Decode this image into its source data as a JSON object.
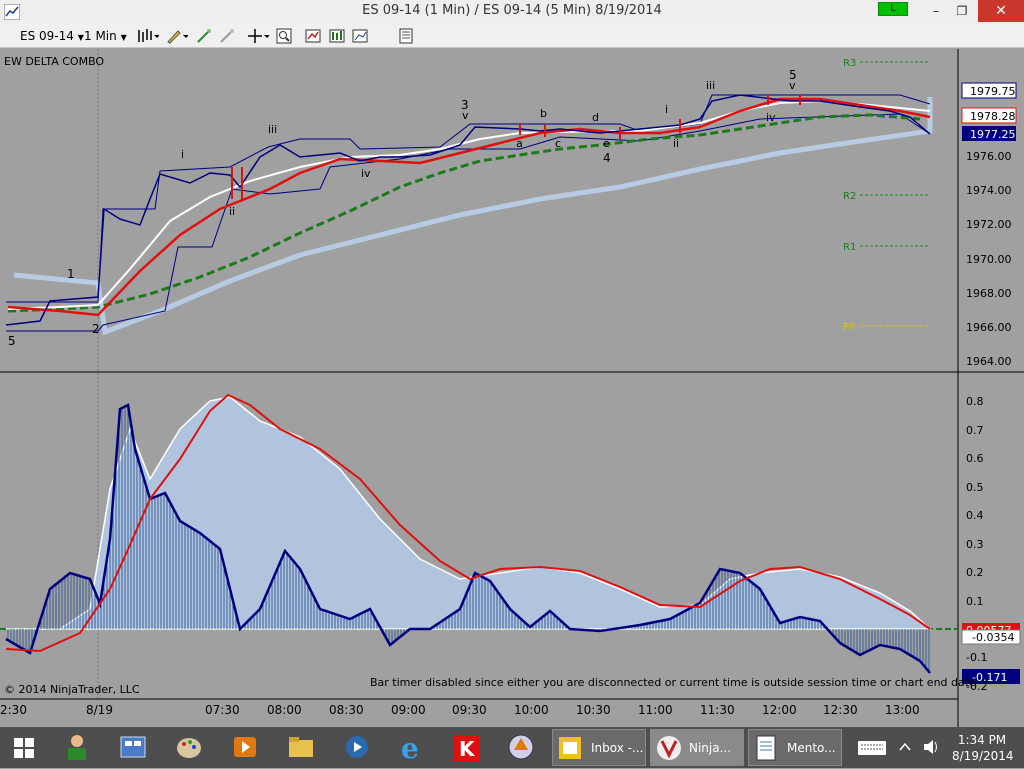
{
  "window": {
    "title": "ES 09-14 (1 Min) / ES 09-14 (5 Min)  8/19/2014",
    "connection_label": "L",
    "minimize_glyph": "–",
    "restore_glyph": "❐",
    "close_glyph": "✕"
  },
  "toolbar": {
    "instrument": "ES 09-14",
    "interval": "1 Min",
    "icons": [
      "bar-type-icon",
      "pencil-draw-icon",
      "magic-wand-icon",
      "eraser-icon",
      "crosshair-icon",
      "zoom-icon",
      "indicators-icon",
      "strategies-icon",
      "chart-properties-icon",
      "templates-icon"
    ]
  },
  "chart": {
    "indicator_label": "EW DELTA COMBO",
    "copyright": "© 2014 NinjaTrader, LLC",
    "status_message": "Bar timer disabled since either you are disconnected or current time is outside session time or chart end date",
    "price_ticks": [
      "1976.00",
      "1974.00",
      "1972.00",
      "1970.00",
      "1968.00",
      "1966.00",
      "1964.00"
    ],
    "price_markers": [
      "1979.75",
      "1978.28",
      "1977.25"
    ],
    "pivot_labels": [
      "R3",
      "R2",
      "R1",
      "PP"
    ],
    "osc_ticks": [
      "0.8",
      "0.7",
      "0.6",
      "0.5",
      "0.4",
      "0.3",
      "0.2",
      "0.1",
      "0",
      "-0.1",
      "-0.2"
    ],
    "osc_markers": [
      "0.00577",
      "-0.0354",
      "-0.171"
    ],
    "time_ticks": [
      "2:30",
      "8/19",
      "07:30",
      "08:00",
      "08:30",
      "09:00",
      "09:30",
      "10:00",
      "10:30",
      "11:00",
      "11:30",
      "12:00",
      "12:30",
      "13:00"
    ],
    "wave_labels": [
      "5",
      "1",
      "2",
      "i",
      "ii",
      "iii",
      "iv",
      "3",
      "v",
      "a",
      "b",
      "c",
      "d",
      "e",
      "4",
      "i",
      "ii",
      "iii",
      "iv",
      "5",
      "v"
    ]
  },
  "colors": {
    "background": "#a0a0a0",
    "price_bars": "#00007f",
    "ema_white": "#ffffff",
    "ema_red": "#e01010",
    "ma_green": "#1e7a1e",
    "ma_lightblue": "#b8cbe4",
    "osc_fill": "#b0c4de",
    "osc_line": "#00007f",
    "pivot_green": "#1e8a1e",
    "pivot_yellow": "#d4c020"
  },
  "taskbar": {
    "apps": [
      "windows-start",
      "people-app",
      "control-panel",
      "paint",
      "media",
      "explorer",
      "quicktime",
      "internet-explorer",
      "kaspersky",
      "app-circle"
    ],
    "inbox_label": "Inbox -...",
    "ninja_label": "Ninja...",
    "mentor_label": "Mento...",
    "clock_time": "1:34 PM",
    "clock_date": "8/19/2014"
  }
}
